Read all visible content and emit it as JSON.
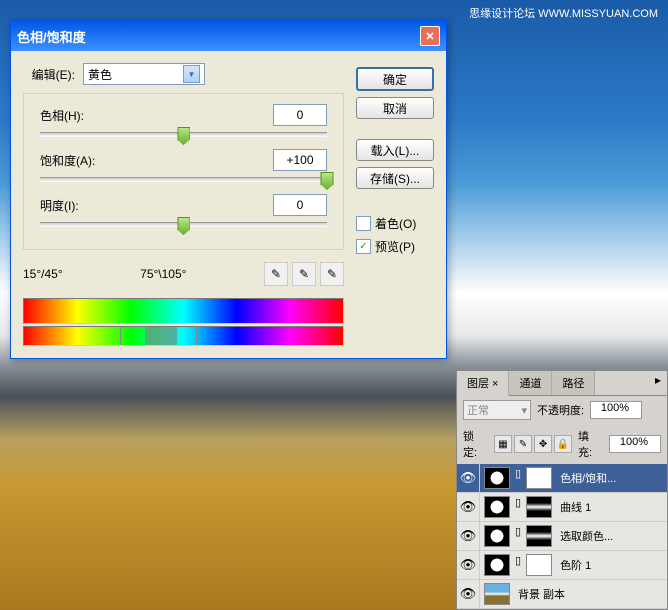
{
  "watermark": "思缘设计论坛  WWW.MISSYUAN.COM",
  "dialog": {
    "title": "色相/饱和度",
    "edit_label": "编辑(E):",
    "edit_value": "黄色",
    "hue": {
      "label": "色相(H):",
      "value": "0",
      "pos": 50
    },
    "saturation": {
      "label": "饱和度(A):",
      "value": "+100",
      "pos": 100
    },
    "lightness": {
      "label": "明度(I):",
      "value": "0",
      "pos": 50
    },
    "range_left": "15°/45°",
    "range_right": "75°\\105°",
    "buttons": {
      "ok": "确定",
      "cancel": "取消",
      "load": "载入(L)...",
      "save": "存储(S)..."
    },
    "colorize": {
      "label": "着色(O)",
      "checked": false
    },
    "preview": {
      "label": "预览(P)",
      "checked": true
    }
  },
  "layers": {
    "tabs": [
      "图层 ×",
      "通道",
      "路径"
    ],
    "blend_label": "正常",
    "opacity_label": "不透明度:",
    "opacity_value": "100%",
    "lock_label": "锁定:",
    "fill_label": "填充:",
    "fill_value": "100%",
    "items": [
      {
        "name": "色相/饱和...",
        "selected": true,
        "adj": true,
        "mask": "white"
      },
      {
        "name": "曲线 1",
        "adj": true,
        "mask": "shape"
      },
      {
        "name": "选取颜色...",
        "adj": true,
        "mask": "shape2"
      },
      {
        "name": "色阶 1",
        "adj": true,
        "mask": "white"
      },
      {
        "name": "背景 副本",
        "img": true
      }
    ]
  }
}
